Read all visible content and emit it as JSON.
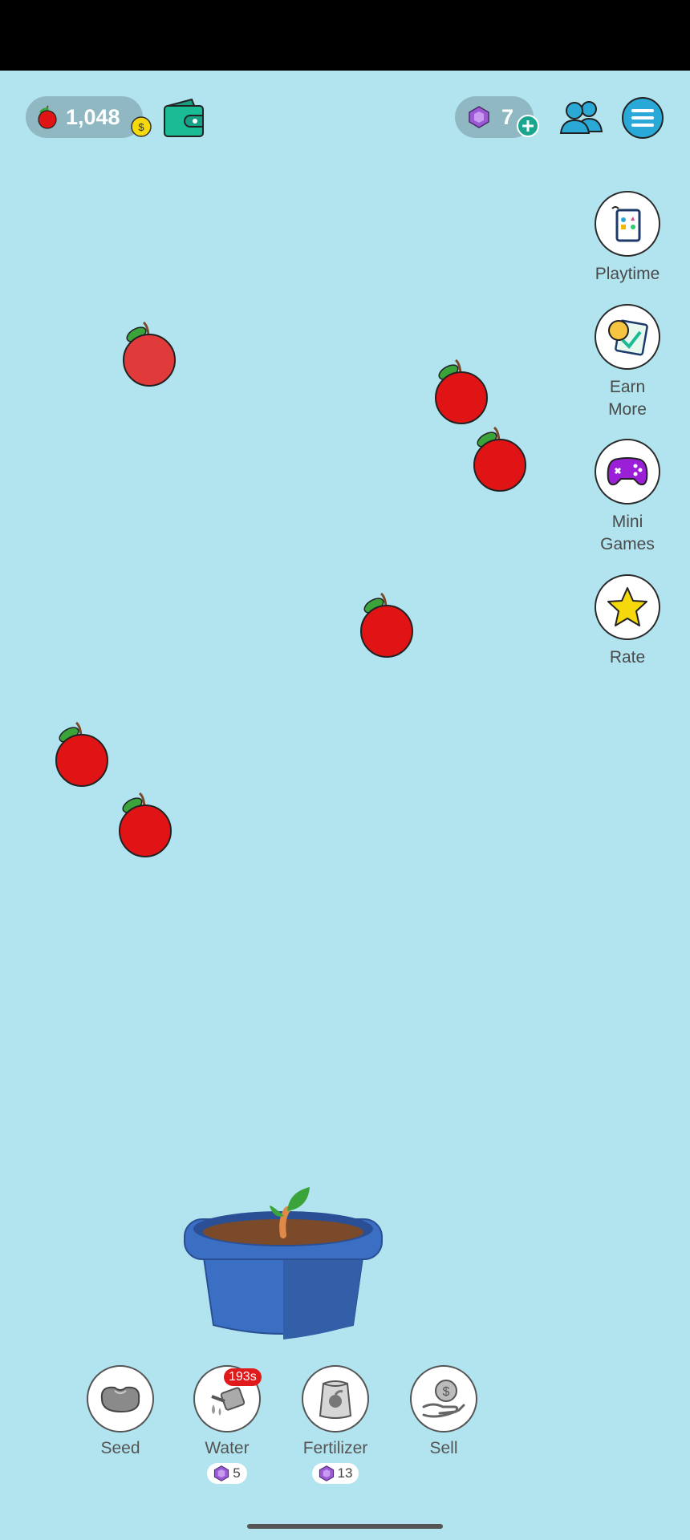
{
  "header": {
    "apples_count": "1,048",
    "gems_count": "7"
  },
  "side_menu": [
    {
      "label": "Playtime",
      "icon": "tablet-games-icon"
    },
    {
      "label": "Earn More",
      "icon": "task-clipboard-icon"
    },
    {
      "label": "Mini Games",
      "icon": "gamepad-icon"
    },
    {
      "label": "Rate",
      "icon": "star-icon"
    }
  ],
  "actions": {
    "seed": {
      "label": "Seed",
      "icon": "seed-icon"
    },
    "water": {
      "label": "Water",
      "icon": "watering-can-icon",
      "timer": "193s",
      "cost": "5"
    },
    "fertilizer": {
      "label": "Fertilizer",
      "icon": "fertilizer-bag-icon",
      "cost": "13"
    },
    "sell": {
      "label": "Sell",
      "icon": "sell-coin-hand-icon"
    }
  },
  "colors": {
    "background": "#b2e4f0",
    "apple": "#e01414",
    "pot": "#3a6fc4",
    "gem": "#9b59d6"
  }
}
